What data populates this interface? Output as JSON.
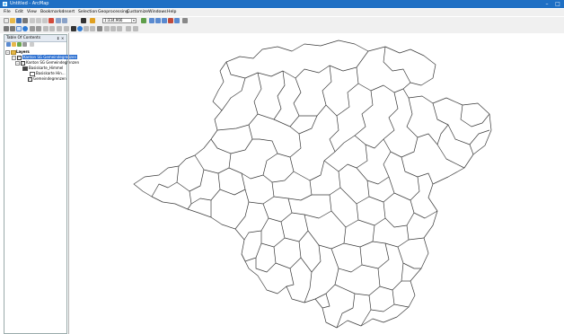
{
  "window": {
    "title": "Untitled - ArcMap",
    "minimize_glyph": "–",
    "maximize_glyph": "□",
    "icon": "arcmap-app-icon"
  },
  "menu": [
    "File",
    "Edit",
    "View",
    "Bookmarks",
    "Insert",
    "Selection",
    "Geoprocessing",
    "Customize",
    "Windows",
    "Help"
  ],
  "toolbar": {
    "scale_value": "1:334.966",
    "scale_caret": "▾"
  },
  "toc": {
    "title": "Table Of Contents",
    "pin_glyph": "↨",
    "close_glyph": "×",
    "tree": {
      "root": {
        "label": "Layers",
        "expander": "−"
      },
      "layers": [
        {
          "label": "Kanton SG Gemeindegrenzen",
          "expander": "−",
          "checked": "✓",
          "selected": true
        },
        {
          "label": "Kanton SG Gemeindegrenzen",
          "expander": "−",
          "checked": "✓",
          "selected": false
        }
      ],
      "sublayers": [
        {
          "label": "Basiskarte_Himmel"
        },
        {
          "label": "Basiskarte Hin..."
        }
      ],
      "extra": {
        "label": "Gemeindegrenzen",
        "checked": "✓"
      }
    }
  },
  "colors": {
    "titlebar": "#1e6fc4",
    "selection": "#2b6fd1",
    "map_outline": "#3a3a3a"
  }
}
